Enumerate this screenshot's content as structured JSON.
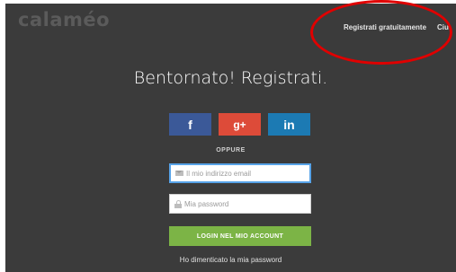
{
  "header": {
    "logo": "calaméo",
    "register_link": "Registrati gratuitamente",
    "more_link": "Ciu"
  },
  "main": {
    "title": "Bentornato! Registrati.",
    "social": {
      "facebook": "f",
      "google": "g+",
      "linkedin": "in"
    },
    "separator": "OPPURE",
    "email_field": {
      "placeholder": "Il mio indirizzo email",
      "value": ""
    },
    "password_field": {
      "placeholder": "Mia password",
      "value": ""
    },
    "login_button": "LOGIN NEL MIO ACCOUNT",
    "forgot_password": "Ho dimenticato la mia password"
  },
  "icons": {
    "email": "envelope-icon",
    "password": "lock-icon"
  },
  "colors": {
    "background": "#3b3b3b",
    "facebook": "#3b5998",
    "google": "#dd4b39",
    "linkedin": "#1c7ab3",
    "login": "#7cb446",
    "annotation": "#e00000"
  }
}
